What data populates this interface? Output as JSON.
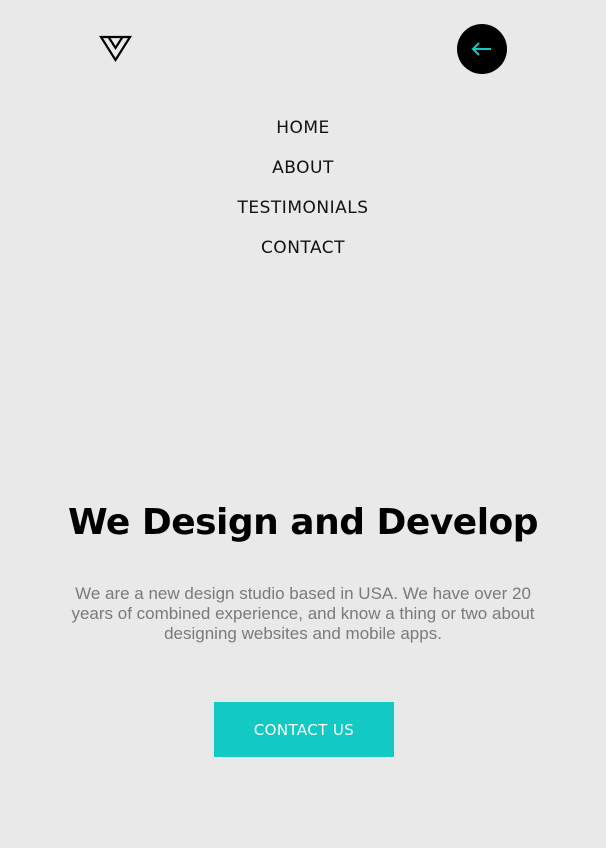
{
  "header": {
    "logo_icon": "triangle-logo-icon",
    "back_icon": "arrow-left-icon",
    "back_icon_color": "#12cac3"
  },
  "nav": {
    "items": [
      {
        "label": "HOME"
      },
      {
        "label": "ABOUT"
      },
      {
        "label": "TESTIMONIALS"
      },
      {
        "label": "CONTACT"
      }
    ]
  },
  "hero": {
    "title": "We Design and Develop",
    "description": "We are a new design studio based in USA. We have over 20 years of combined experience, and know a thing or two about designing websites and mobile apps.",
    "cta_label": "CONTACT US"
  },
  "colors": {
    "background": "#e9e9e9",
    "accent": "#12cac3",
    "text_dark": "#111111",
    "text_muted": "#7a7a7a"
  }
}
